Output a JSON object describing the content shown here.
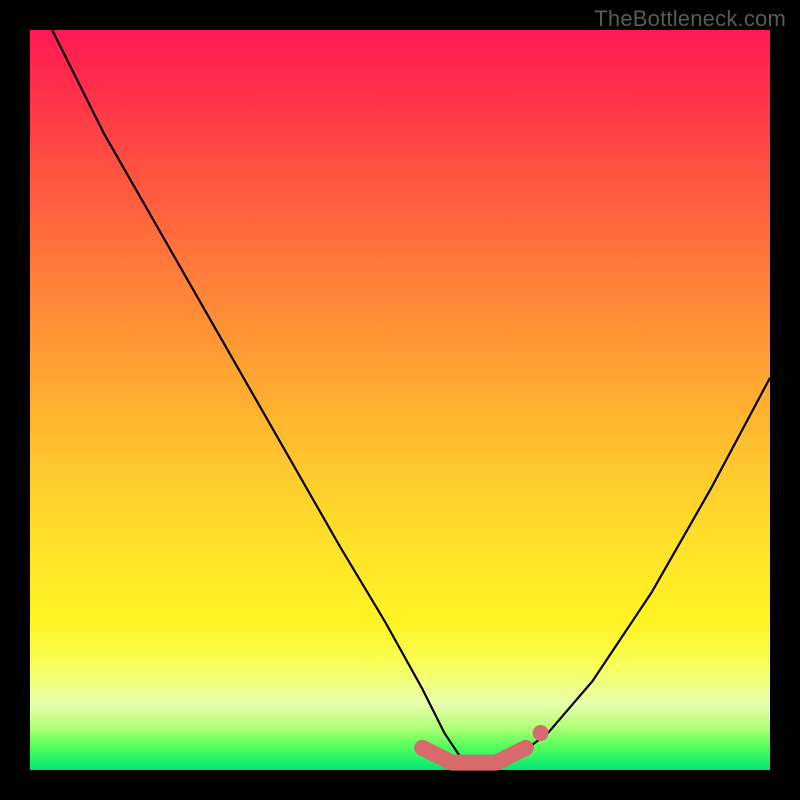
{
  "watermark": "TheBottleneck.com",
  "colors": {
    "frame": "#000000",
    "curve": "#000000",
    "marker_fill": "#d76b6b",
    "marker_stroke": "#c85a5a"
  },
  "chart_data": {
    "type": "line",
    "title": "",
    "xlabel": "",
    "ylabel": "",
    "xlim": [
      0,
      100
    ],
    "ylim": [
      0,
      100
    ],
    "note": "Background maps value (ylim) from ~100 (red, high bottleneck) down to ~0 (green, no bottleneck). Curve shows bottleneck % vs. an implicit horizontal parameter. Minimum sits around x≈58–65 at y≈0–3. Marker cluster (salmon) sits on the valley floor.",
    "series": [
      {
        "name": "bottleneck-curve",
        "x": [
          3,
          10,
          18,
          26,
          34,
          42,
          48,
          53,
          56,
          58,
          60,
          62,
          64,
          66,
          70,
          76,
          84,
          92,
          100
        ],
        "y": [
          100,
          86,
          72,
          58,
          44,
          30,
          20,
          11,
          5,
          2,
          1,
          1,
          1,
          2,
          5,
          12,
          24,
          38,
          53
        ]
      }
    ],
    "markers": {
      "name": "highlight-range",
      "x": [
        53,
        55,
        57,
        59,
        61,
        63,
        65,
        67
      ],
      "y": [
        3,
        2,
        1,
        1,
        1,
        1,
        2,
        3
      ]
    }
  }
}
